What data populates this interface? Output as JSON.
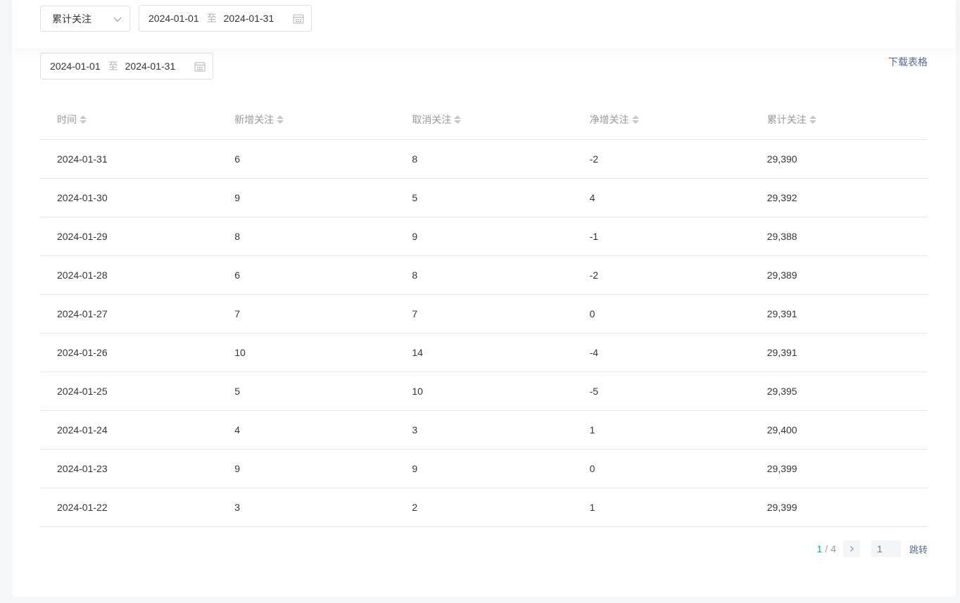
{
  "filter": {
    "select_value": "累计关注",
    "range": {
      "start": "2024-01-01",
      "separator": "至",
      "end": "2024-01-31"
    }
  },
  "table_section": {
    "range": {
      "start": "2024-01-01",
      "separator": "至",
      "end": "2024-01-31"
    },
    "download_label": "下载表格"
  },
  "table": {
    "headers": [
      "时间",
      "新增关注",
      "取消关注",
      "净增关注",
      "累计关注"
    ],
    "rows": [
      [
        "2024-01-31",
        "6",
        "8",
        "-2",
        "29,390"
      ],
      [
        "2024-01-30",
        "9",
        "5",
        "4",
        "29,392"
      ],
      [
        "2024-01-29",
        "8",
        "9",
        "-1",
        "29,388"
      ],
      [
        "2024-01-28",
        "6",
        "8",
        "-2",
        "29,389"
      ],
      [
        "2024-01-27",
        "7",
        "7",
        "0",
        "29,391"
      ],
      [
        "2024-01-26",
        "10",
        "14",
        "-4",
        "29,391"
      ],
      [
        "2024-01-25",
        "5",
        "10",
        "-5",
        "29,395"
      ],
      [
        "2024-01-24",
        "4",
        "3",
        "1",
        "29,400"
      ],
      [
        "2024-01-23",
        "9",
        "9",
        "0",
        "29,399"
      ],
      [
        "2024-01-22",
        "3",
        "2",
        "1",
        "29,399"
      ]
    ]
  },
  "pagination": {
    "current": "1",
    "separator": "/",
    "total": "4",
    "jump_placeholder": "1",
    "jump_label": "跳转"
  },
  "icons": {
    "select": "chevron-down-icon",
    "date": "calendar-icon",
    "sort": "sort-icon",
    "next": "chevron-right-icon"
  },
  "colors": {
    "accent": "#07c160",
    "link": "#576b95",
    "muted": "#9a9a9a"
  }
}
